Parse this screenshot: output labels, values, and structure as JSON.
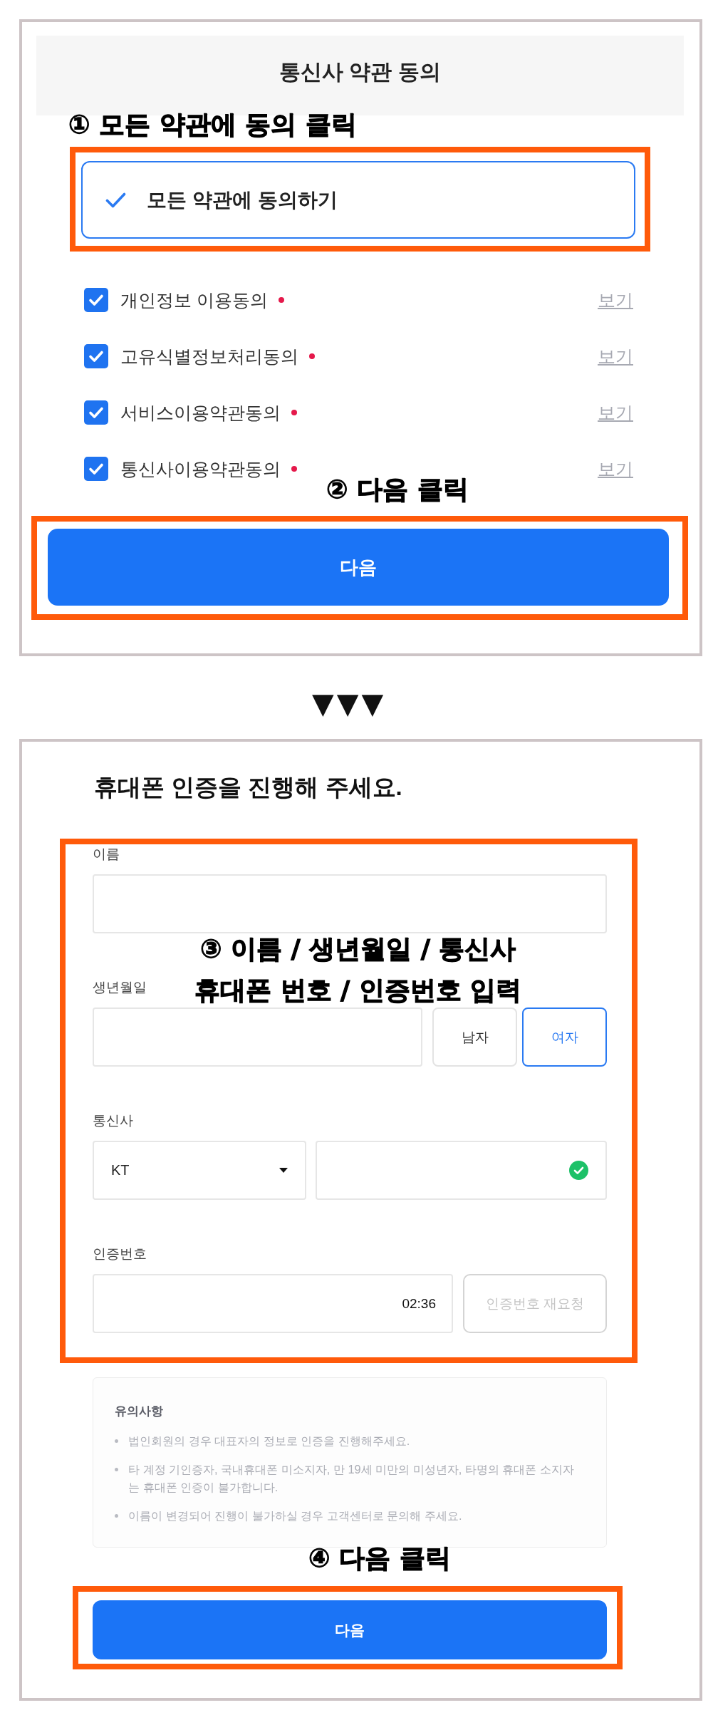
{
  "step1": {
    "title": "통신사 약관 동의",
    "annotation": "① 모든 약관에 동의 클릭",
    "agree_all": {
      "label": "모든 약관에 동의하기",
      "checked": true
    },
    "terms": [
      {
        "label": "개인정보 이용동의",
        "checked": true,
        "required": true,
        "link": "보기"
      },
      {
        "label": "고유식별정보처리동의",
        "checked": true,
        "required": true,
        "link": "보기"
      },
      {
        "label": "서비스이용약관동의",
        "checked": true,
        "required": true,
        "link": "보기"
      },
      {
        "label": "통신사이용약관동의",
        "checked": true,
        "required": true,
        "link": "보기"
      }
    ],
    "annotation_2": "② 다음 클릭",
    "next_button": "다음"
  },
  "divider": "▼▼▼",
  "step2": {
    "heading": "휴대폰 인증을 진행해 주세요.",
    "annotation": [
      "③ 이름 / 생년월일 / 통신사",
      "휴대폰 번호 / 인증번호 입력"
    ],
    "name_field": {
      "label": "이름"
    },
    "birth_field": {
      "label": "생년월일"
    },
    "gender": [
      {
        "label": "남자",
        "selected": false
      },
      {
        "label": "여자",
        "selected": true
      }
    ],
    "carrier": {
      "label": "통신사",
      "value": "KT"
    },
    "phone_field": {
      "verified": true
    },
    "code_field": {
      "label": "인증번호",
      "timer": "02:36"
    },
    "resend_button": {
      "label": "인증번호 재요청",
      "disabled": true
    },
    "notice": {
      "title": "유의사항",
      "items": [
        "법인회원의 경우 대표자의 정보로 인증을 진행해주세요.",
        "타 계정 기인증자, 국내휴대폰 미소지자, 만 19세 미만의 미성년자, 타명의 휴대폰 소지자는 휴대폰 인증이 불가합니다.",
        "이름이 변경되어 진행이 불가하실 경우 고객센터로 문의해 주세요."
      ]
    },
    "annotation_2": "④ 다음 클릭",
    "next_button": "다음"
  }
}
